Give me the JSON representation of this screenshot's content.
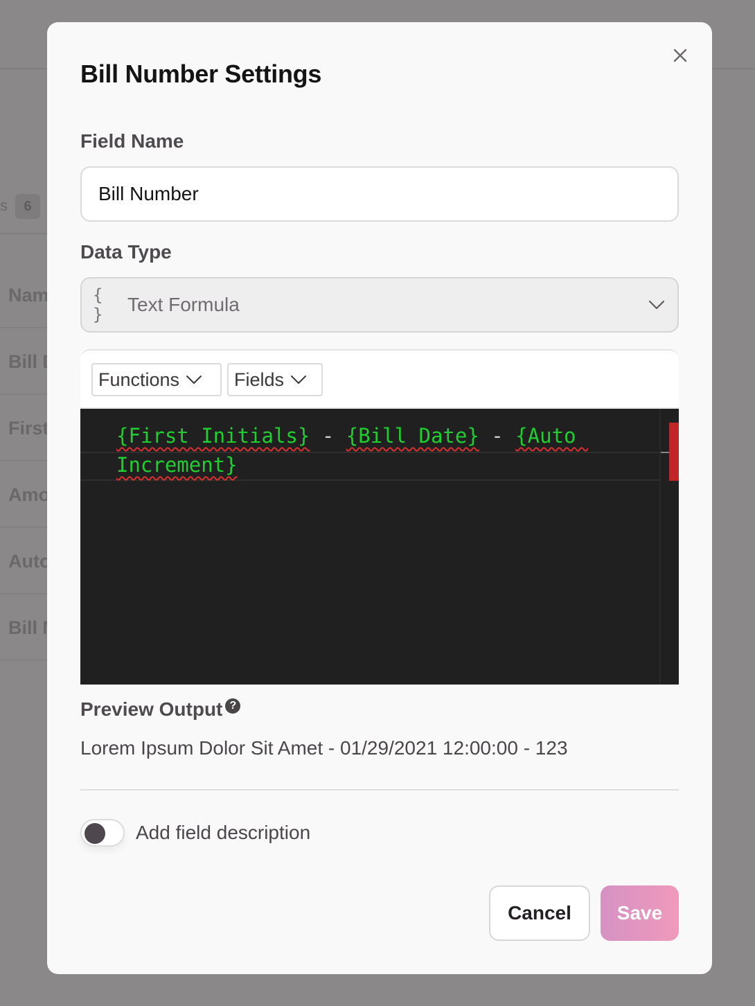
{
  "background": {
    "tab_fragment": "s",
    "tab_count": "6",
    "rows": [
      "Nam",
      "Bill D",
      "First",
      "Amo",
      "Auto",
      "Bill N"
    ]
  },
  "modal": {
    "title": "Bill Number Settings",
    "close_icon": "close-icon"
  },
  "field_name": {
    "label": "Field Name",
    "value": "Bill Number"
  },
  "data_type": {
    "label": "Data Type",
    "icon": "{ }",
    "value": "Text Formula"
  },
  "formula": {
    "toolbar": {
      "functions_label": "Functions",
      "fields_label": "Fields"
    },
    "tokens": [
      "{First Initials}",
      " - ",
      "{Bill Date}",
      " - ",
      "{Auto Increment}"
    ]
  },
  "preview": {
    "label": "Preview Output",
    "help_icon": "?",
    "value": "Lorem Ipsum Dolor Sit Amet - 01/29/2021 12:00:00 - 123"
  },
  "description_toggle": {
    "label": "Add field description",
    "enabled": false
  },
  "footer": {
    "cancel_label": "Cancel",
    "save_label": "Save"
  },
  "colors": {
    "overlay": "#8a8889",
    "save_gradient_start": "#d592c3",
    "save_gradient_end": "#f099bb",
    "formula_text": "#1fcf2f",
    "editor_bg": "#202020",
    "error_marker": "#c02626"
  }
}
